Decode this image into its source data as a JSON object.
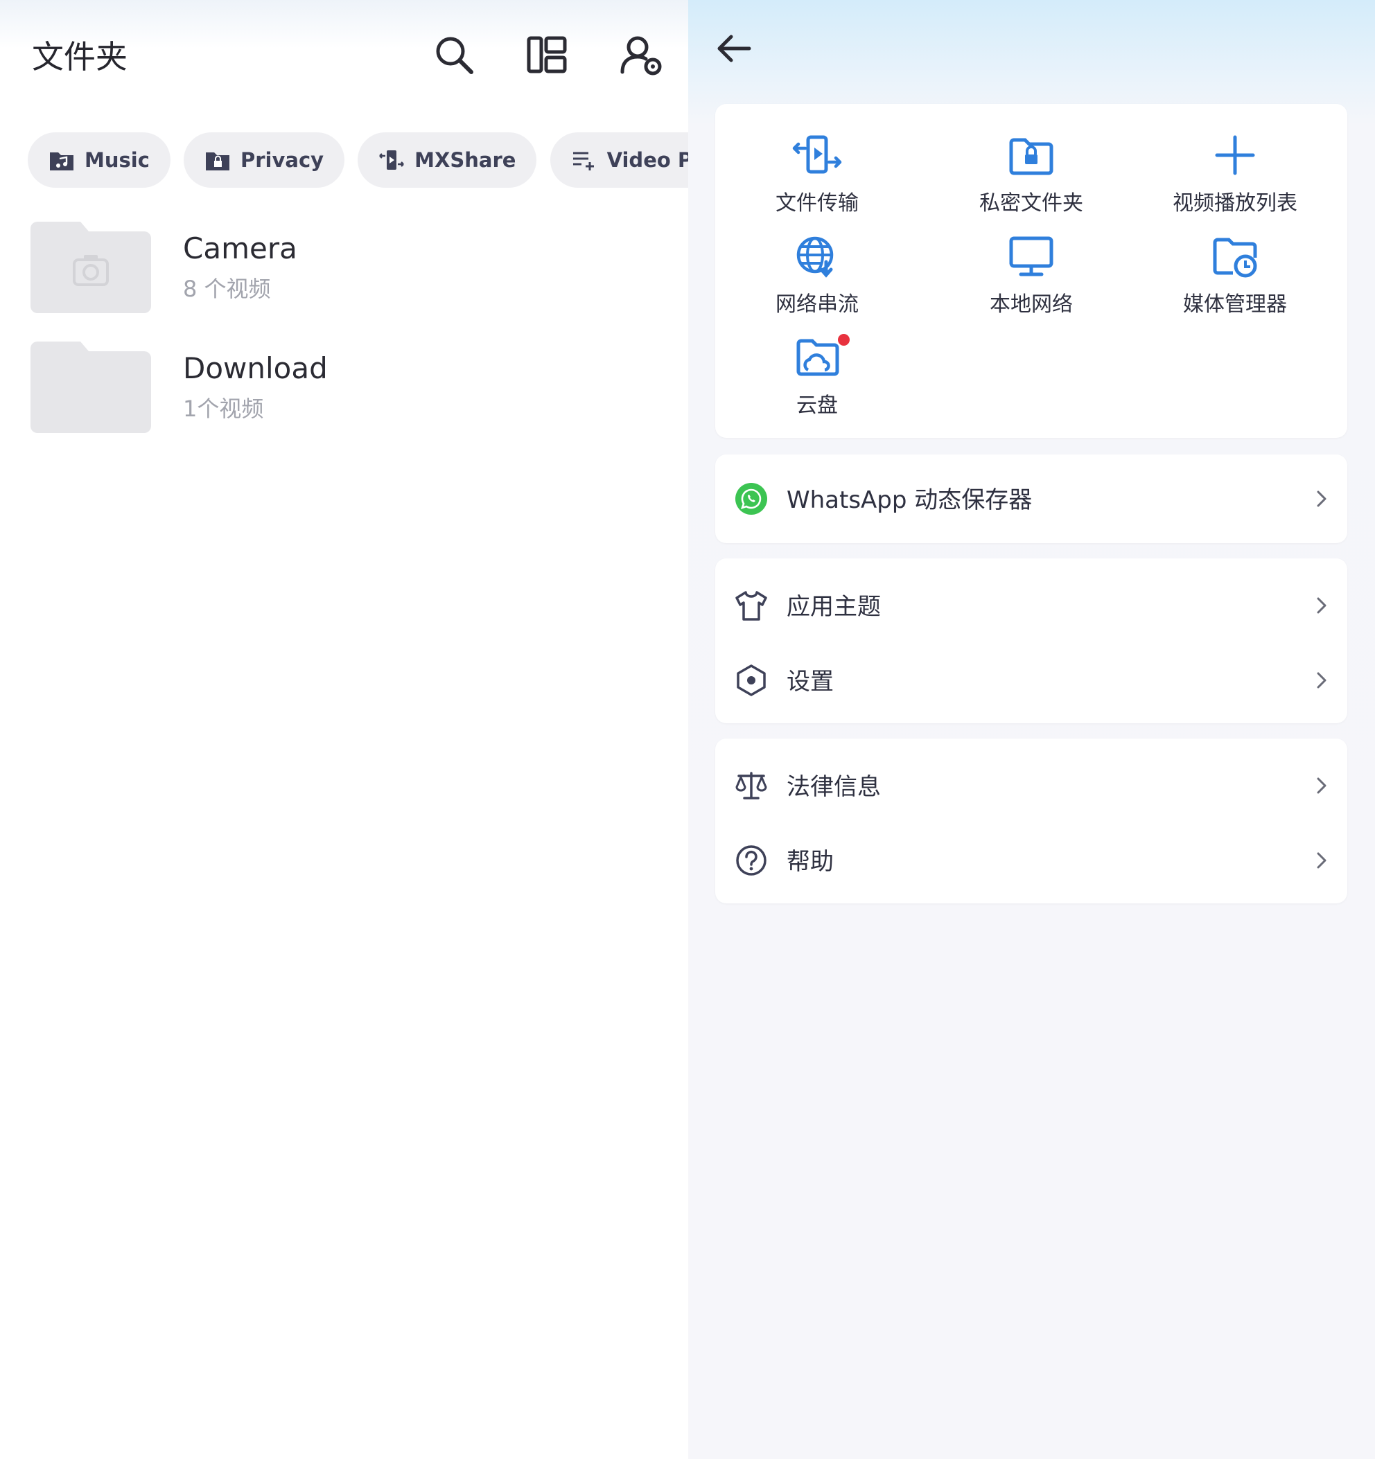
{
  "left": {
    "title": "文件夹",
    "chips": [
      {
        "label": "Music",
        "icon": "music-folder-icon"
      },
      {
        "label": "Privacy",
        "icon": "lock-folder-icon"
      },
      {
        "label": "MXShare",
        "icon": "file-transfer-icon"
      },
      {
        "label": "Video Playlist",
        "icon": "playlist-add-icon"
      }
    ],
    "folders": [
      {
        "name": "Camera",
        "count": "8 个视频",
        "icon": "camera-icon"
      },
      {
        "name": "Download",
        "count": "1个视频",
        "icon": "folder-icon"
      }
    ]
  },
  "right": {
    "grid": [
      {
        "label": "文件传输",
        "icon": "file-transfer-icon"
      },
      {
        "label": "私密文件夹",
        "icon": "private-folder-icon"
      },
      {
        "label": "视频播放列表",
        "icon": "plus-icon"
      },
      {
        "label": "网络串流",
        "icon": "network-stream-icon"
      },
      {
        "label": "本地网络",
        "icon": "monitor-icon"
      },
      {
        "label": "媒体管理器",
        "icon": "media-manager-icon"
      },
      {
        "label": "云盘",
        "icon": "cloud-folder-icon"
      }
    ],
    "whatsapp": {
      "label": "WhatsApp 动态保存器"
    },
    "theme": {
      "label": "应用主题"
    },
    "settings": {
      "label": "设置"
    },
    "legal": {
      "label": "法律信息"
    },
    "help": {
      "label": "帮助"
    }
  },
  "colors": {
    "accent": "#2f7fdc",
    "chip_bg": "#efeff2",
    "whatsapp_green": "#3cc452",
    "badge_red": "#e8323e"
  }
}
